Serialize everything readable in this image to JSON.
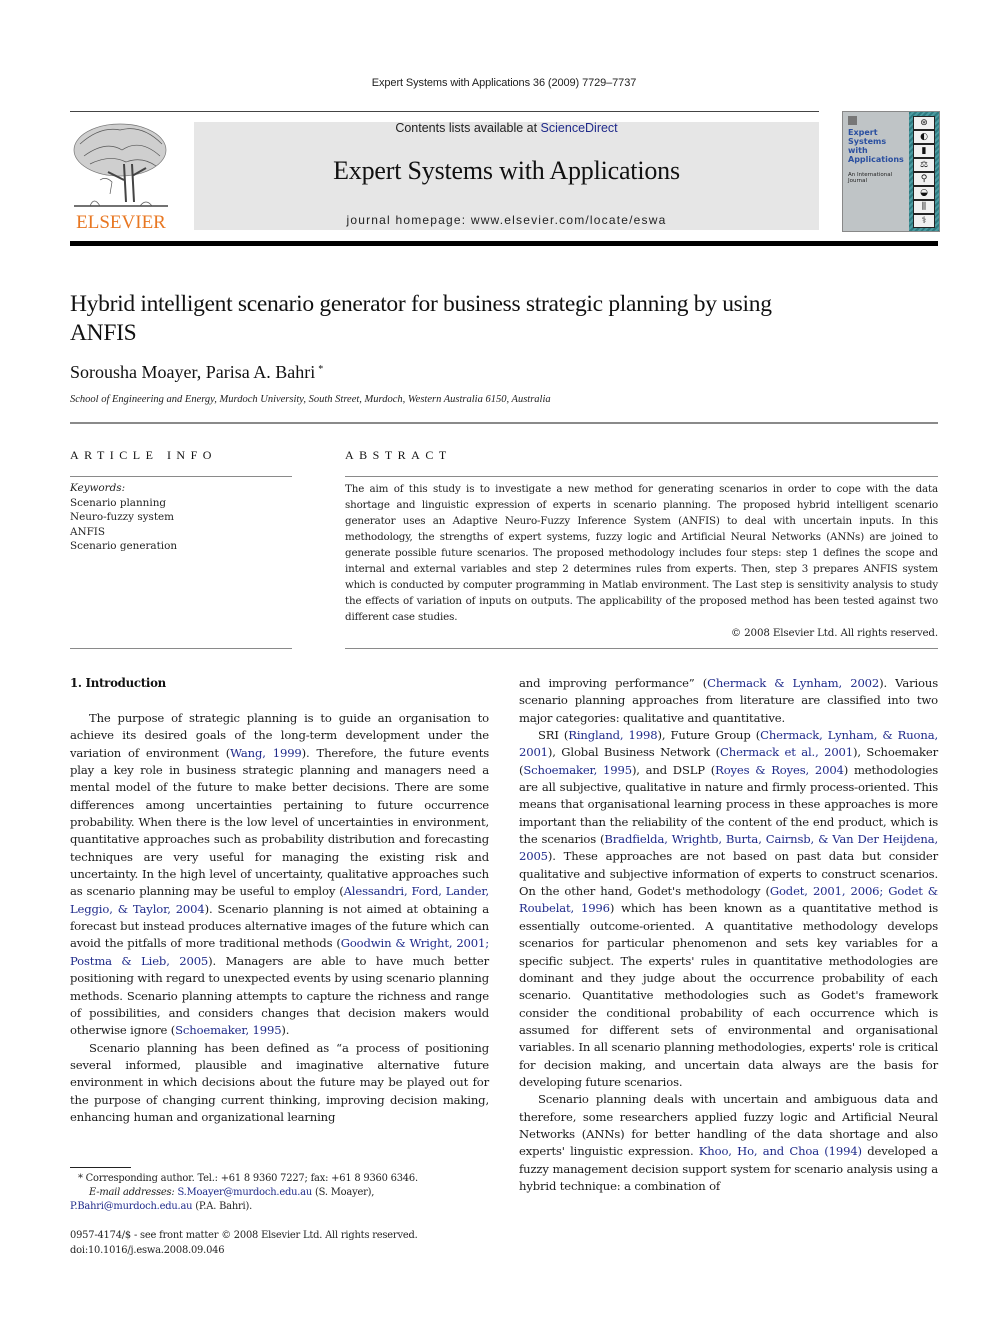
{
  "running_head": "Expert Systems with Applications 36 (2009) 7729–7737",
  "masthead": {
    "publisher_logo_label": "ELSEVIER",
    "contents_prefix": "Contents lists available at ",
    "contents_link": "ScienceDirect",
    "journal_title": "Expert Systems with Applications",
    "homepage": "journal homepage: www.elsevier.com/locate/eswa",
    "cover": {
      "title_lines": [
        "Expert",
        "Systems",
        "with",
        "Applications"
      ],
      "subtitle": "An International Journal"
    }
  },
  "colors": {
    "link": "#1f2a8a",
    "elsevier_orange": "#e87722",
    "banner_gray": "#e6e6e6",
    "cover_teal": "#2e7a80"
  },
  "article": {
    "title": "Hybrid intelligent scenario generator for business strategic planning by using ANFIS",
    "authors": "Sorousha Moayer, Parisa A. Bahri",
    "corresponding_mark": "*",
    "affiliation": "School of Engineering and Energy, Murdoch University, South Street, Murdoch, Western Australia 6150, Australia"
  },
  "article_info": {
    "heading": "ARTICLE INFO",
    "keywords_label": "Keywords:",
    "keywords": [
      "Scenario planning",
      "Neuro-fuzzy system",
      "ANFIS",
      "Scenario generation"
    ]
  },
  "abstract": {
    "heading": "ABSTRACT",
    "text": "The aim of this study is to investigate a new method for generating scenarios in order to cope with the data shortage and linguistic expression of experts in scenario planning. The proposed hybrid intelligent scenario generator uses an Adaptive Neuro-Fuzzy Inference System (ANFIS) to deal with uncertain inputs. In this methodology, the strengths of expert systems, fuzzy logic and Artificial Neural Networks (ANNs) are joined to generate possible future scenarios. The proposed methodology includes four steps: step 1 defines the scope and internal and external variables and step 2 determines rules from experts. Then, step 3 prepares ANFIS system which is conducted by computer programming in Matlab environment. The Last step is sensitivity analysis to study the effects of variation of inputs on outputs. The applicability of the proposed method has been tested against two different case studies.",
    "copyright": "© 2008 Elsevier Ltd. All rights reserved."
  },
  "body": {
    "section_heading": "1. Introduction",
    "left_col": {
      "p1": [
        {
          "t": "The purpose of strategic planning is to guide an organisation to achieve its desired goals of the long-term development under the variation of environment ("
        },
        {
          "t": "Wang, 1999",
          "link": true
        },
        {
          "t": "). Therefore, the future events play a key role in business strategic planning and managers need a mental model of the future to make better decisions. There are some differences among uncertainties pertaining to future occurrence probability. When there is the low level of uncertainties in environment, quantitative approaches such as probability distribution and forecasting techniques are very useful for managing the existing risk and uncertainty. In the high level of uncertainty, qualitative approaches such as scenario planning may be useful to employ ("
        },
        {
          "t": "Alessandri, Ford, Lander, Leggio, & Taylor, 2004",
          "link": true
        },
        {
          "t": "). Scenario planning is not aimed at obtaining a forecast but instead produces alternative images of the future which can avoid the pitfalls of more traditional methods ("
        },
        {
          "t": "Goodwin & Wright, 2001; Postma & Lieb, 2005",
          "link": true
        },
        {
          "t": "). Managers are able to have much better positioning with regard to unexpected events by using scenario planning methods. Scenario planning attempts to capture the richness and range of possibilities, and considers changes that decision makers would otherwise ignore ("
        },
        {
          "t": "Schoemaker, 1995",
          "link": true
        },
        {
          "t": ")."
        }
      ],
      "p2": [
        {
          "t": "Scenario planning has been defined as “a process of positioning several informed, plausible and imaginative alternative future environment in which decisions about the future may be played out for the purpose of changing current thinking, improving decision making, enhancing human and organizational learning"
        }
      ]
    },
    "right_col": {
      "p1": [
        {
          "t": "and improving performance” ("
        },
        {
          "t": "Chermack & Lynham, 2002",
          "link": true
        },
        {
          "t": "). Various scenario planning approaches from literature are classified into two major categories: qualitative and quantitative."
        }
      ],
      "p2": [
        {
          "t": "SRI ("
        },
        {
          "t": "Ringland, 1998",
          "link": true
        },
        {
          "t": "), Future Group ("
        },
        {
          "t": "Chermack, Lynham, & Ruona, 2001",
          "link": true
        },
        {
          "t": "), Global Business Network ("
        },
        {
          "t": "Chermack et al., 2001",
          "link": true
        },
        {
          "t": "), Schoemaker ("
        },
        {
          "t": "Schoemaker, 1995",
          "link": true
        },
        {
          "t": "), and DSLP ("
        },
        {
          "t": "Royes & Royes, 2004",
          "link": true
        },
        {
          "t": ") methodologies are all subjective, qualitative in nature and firmly process-oriented. This means that organisational learning process in these approaches is more important than the reliability of the content of the end product, which is the scenarios ("
        },
        {
          "t": "Bradfielda, Wrightb, Burta, Cairnsb, & Van Der Heijdena, 2005",
          "link": true
        },
        {
          "t": "). These approaches are not based on past data but consider qualitative and subjective information of experts to construct scenarios. On the other hand, Godet's methodology ("
        },
        {
          "t": "Godet, 2001, 2006; Godet & Roubelat, 1996",
          "link": true
        },
        {
          "t": ") which has been known as a quantitative method is essentially outcome-oriented. A quantitative methodology develops scenarios for particular phenomenon and sets key variables for a specific subject. The experts' rules in quantitative methodologies are dominant and they judge about the occurrence probability of each scenario. Quantitative methodologies such as Godet's framework consider the conditional probability of each occurrence which is assumed for different sets of environmental and organisational variables. In all scenario planning methodologies, experts' role is critical for decision making, and uncertain data always are the basis for developing future scenarios."
        }
      ],
      "p3": [
        {
          "t": "Scenario planning deals with uncertain and ambiguous data and therefore, some researchers applied fuzzy logic and Artificial Neural Networks (ANNs) for better handling of the data shortage and also experts' linguistic expression. "
        },
        {
          "t": "Khoo, Ho, and Choa (1994)",
          "link": true
        },
        {
          "t": " developed a fuzzy management decision support system for scenario analysis using a hybrid technique: a combination of"
        }
      ]
    }
  },
  "footnotes": {
    "corresponding": "* Corresponding author. Tel.: +61 8 9360 7227; fax: +61 8 9360 6346.",
    "email_label": "E-mail addresses:",
    "email1": "S.Moayer@murdoch.edu.au",
    "email1_name": " (S. Moayer), ",
    "email2": "P.Bahri@murdoch.edu.au",
    "email2_name": " (P.A. Bahri)."
  },
  "issn_line": "0957-4174/$ - see front matter © 2008 Elsevier Ltd. All rights reserved.",
  "doi": "doi:10.1016/j.eswa.2008.09.046"
}
